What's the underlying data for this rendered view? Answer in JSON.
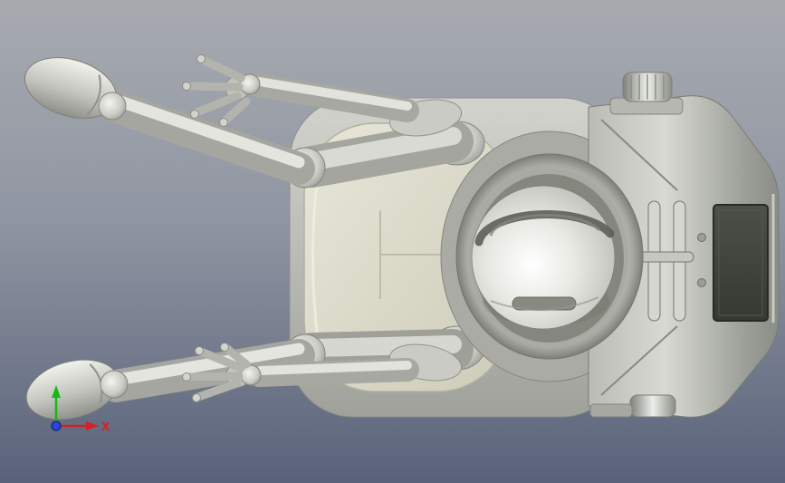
{
  "viewport": {
    "type": "3d-cad-viewport",
    "background": {
      "top": "#a7abb0",
      "middle": "#9096a2",
      "bottom": "#59627a"
    }
  },
  "triad": {
    "x_label": "X",
    "colors": {
      "x": "#d42222",
      "y": "#15b815",
      "origin": "#2b46e0"
    }
  },
  "model": {
    "name": "humanoid-robot-top-view",
    "palette": {
      "metal_highlight": "#f2f2ee",
      "metal_light": "#d8d9d3",
      "metal_mid": "#b0b2ab",
      "metal_shadow": "#83857e",
      "plate": "#dbdaca",
      "panel_dark": "#3f443c",
      "visor": "#5c5f55"
    }
  }
}
